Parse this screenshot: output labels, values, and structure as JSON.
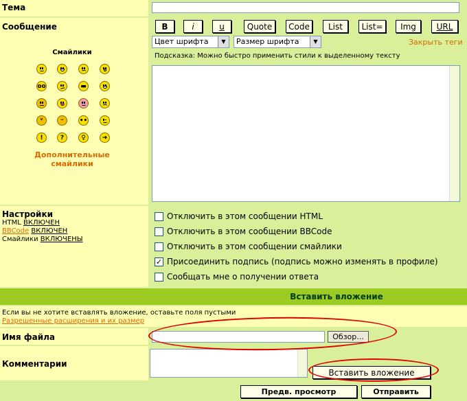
{
  "subject": {
    "label": "Тема",
    "value": ""
  },
  "message": {
    "label": "Сообщение",
    "smilies_title": "Смайлики",
    "more_smilies": "Дополнительные смайлики",
    "smilies": [
      "smile",
      "biggrin",
      "sad",
      "surprised",
      "eek",
      "confused",
      "cool",
      "lol",
      "mad",
      "razz",
      "redface",
      "cry",
      "evil",
      "twisted",
      "rolleyes",
      "wink",
      "exclaim",
      "question",
      "idea",
      "arrow"
    ]
  },
  "toolbar": {
    "buttons": [
      "B",
      "i",
      "u",
      "Quote",
      "Code",
      "List",
      "List=",
      "Img",
      "URL"
    ],
    "close_tags": "Закрыть теги",
    "font_color": "Цвет шрифта",
    "font_size": "Размер шрифта",
    "hint": "Подсказка: Можно быстро применить стили к выделенному тексту"
  },
  "message_body": "",
  "settings": {
    "label": "Настройки",
    "html_label": "HTML",
    "html_state": "ВКЛЮЧЕН",
    "bbcode_label": "BBCode",
    "bbcode_state": "ВКЛЮЧЕН",
    "smilies_label": "Смайлики",
    "smilies_state": "ВКЛЮЧЕНЫ",
    "options": [
      {
        "label": "Отключить в этом сообщении HTML",
        "checked": false
      },
      {
        "label": "Отключить в этом сообщении BBCode",
        "checked": false
      },
      {
        "label": "Отключить в этом сообщении смайлики",
        "checked": false
      },
      {
        "label": "Присоединить подпись (подпись можно изменять в профиле)",
        "checked": true
      },
      {
        "label": "Сообщать мне о получении ответа",
        "checked": false
      }
    ]
  },
  "attachment": {
    "header": "Вставить вложение",
    "note": "Если вы не хотите вставлять вложение, оставьте поля пустыми",
    "allowed_link": "Разрешенные расширения и их размер",
    "filename_label": "Имя файла",
    "browse": "Обзор...",
    "comment_label": "Комментарии",
    "insert_button": "Вставить вложение"
  },
  "footer": {
    "preview": "Предв. просмотр",
    "submit": "Отправить"
  },
  "colors": {
    "green_bg": "#d9ef9a",
    "yellow_bg": "#ffffb3",
    "header_bar": "#9ccc24",
    "orange": "#d86a00",
    "annotation_red": "#e00000"
  }
}
